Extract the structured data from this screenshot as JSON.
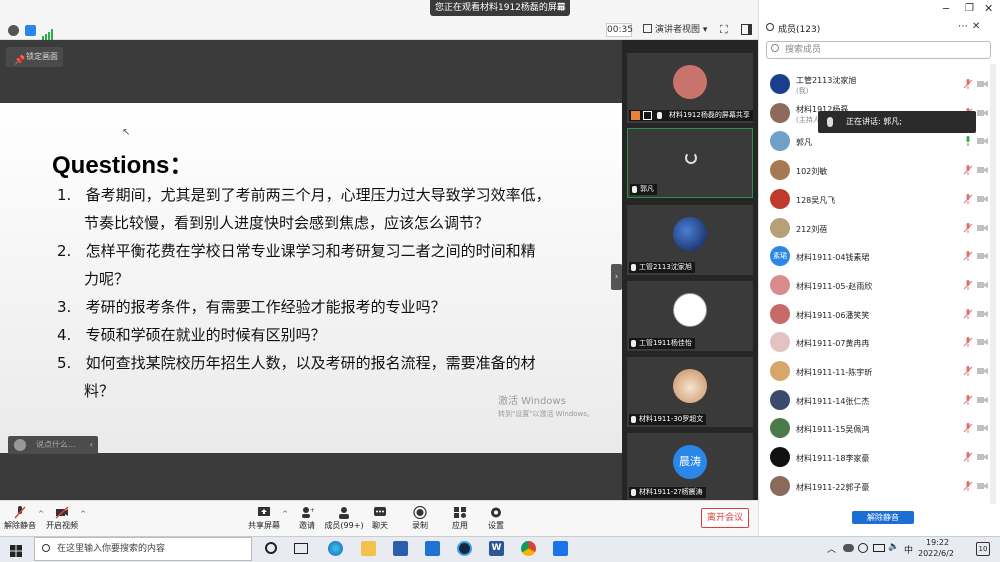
{
  "top": {
    "viewing_banner": "您正在观看材料1912杨磊的屏幕",
    "timer": "00:35",
    "view_mode": "演讲者视图"
  },
  "share": {
    "lock_label": "锁定画面",
    "chat_placeholder": "说点什么...",
    "slide": {
      "title": "Questions：",
      "questions": [
        {
          "num": "1.",
          "lines": [
            "备考期间，尤其是到了考前两三个月，心理压力过大导致学习效率低，",
            "节奏比较慢，看到别人进度快时会感到焦虑，应该怎么调节？"
          ]
        },
        {
          "num": "2.",
          "lines": [
            "怎样平衡花费在学校日常专业课学习和考研复习二者之间的时间和精",
            "力呢？"
          ]
        },
        {
          "num": "3.",
          "lines": [
            "考研的报考条件，有需要工作经验才能报考的专业吗？"
          ]
        },
        {
          "num": "4.",
          "lines": [
            "专硕和学硕在就业的时候有区别吗？"
          ]
        },
        {
          "num": "5.",
          "lines": [
            "如何查找某院校历年招生人数，以及考研的报名流程，需要准备的材",
            "料？"
          ]
        }
      ],
      "watermark_line1": "激活 Windows",
      "watermark_line2": "转到\"设置\"以激活 Windows。"
    }
  },
  "video_tiles": [
    {
      "label": "材料1912杨磊的屏幕共享",
      "avatar_color": "#c9736d"
    },
    {
      "label": "郭凡",
      "avatar_color": ""
    },
    {
      "label": "工管2113沈家旭",
      "avatar_color": "#1b3f8f"
    },
    {
      "label": "工管1911杨佳怡",
      "avatar_color": "#ffffff"
    },
    {
      "label": "材料1911-30罗超文",
      "avatar_color": "#e8c7a0"
    },
    {
      "label": "材料1911-2?杨晨涛",
      "avatar_color": "#2a86e8",
      "avatar_text": "晨涛"
    }
  ],
  "toolbar": {
    "unmute": "解除静音",
    "start_video": "开启视频",
    "share_screen": "共享屏幕",
    "invite": "邀请",
    "members": "成员(99+)",
    "chat": "聊天",
    "record": "录制",
    "apps": "应用",
    "settings": "设置",
    "leave": "离开会议"
  },
  "members_panel": {
    "title": "成员(123)",
    "search_placeholder": "搜索成员",
    "speaking_tip": "正在讲话: 郭凡;",
    "unmute_all": "解除静音",
    "members": [
      {
        "name": "工管2113沈家旭",
        "sub": "(我)",
        "avatar_color": "#1b3f8f",
        "mic_on": false
      },
      {
        "name": "材料1912杨磊",
        "sub": "(主持人)",
        "avatar_color": "#8c6b5c",
        "mic_on": false
      },
      {
        "name": "郭凡",
        "sub": "",
        "avatar_color": "#6fa0c8",
        "mic_on": true
      },
      {
        "name": "102刘敏",
        "sub": "",
        "avatar_color": "#a57a50",
        "mic_on": false
      },
      {
        "name": "128吴凡飞",
        "sub": "",
        "avatar_color": "#c03a2b",
        "mic_on": false
      },
      {
        "name": "212刘蓓",
        "sub": "",
        "avatar_color": "#b5a07a",
        "mic_on": false
      },
      {
        "name": "材料1911-04钱素珺",
        "sub": "",
        "avatar_color": "#2a86e8",
        "avatar_text": "素珺",
        "mic_on": false
      },
      {
        "name": "材料1911-05-赵雨欣",
        "sub": "",
        "avatar_color": "#d98c8c",
        "mic_on": false
      },
      {
        "name": "材料1911-06潘笑笑",
        "sub": "",
        "avatar_color": "#c76a6a",
        "mic_on": false
      },
      {
        "name": "材料1911-07黄冉冉",
        "sub": "",
        "avatar_color": "#e2c3c0",
        "mic_on": false
      },
      {
        "name": "材料1911-11-陈宇昕",
        "sub": "",
        "avatar_color": "#d8a66a",
        "mic_on": false
      },
      {
        "name": "材料1911-14张仁杰",
        "sub": "",
        "avatar_color": "#3a4a6a",
        "mic_on": false
      },
      {
        "name": "材料1911-15吴佩鸿",
        "sub": "",
        "avatar_color": "#4a7a4a",
        "mic_on": false
      },
      {
        "name": "材料1911-18李家豪",
        "sub": "",
        "avatar_color": "#111111",
        "mic_on": false
      },
      {
        "name": "材料1911-22郭子豪",
        "sub": "",
        "avatar_color": "#8a6a5a",
        "mic_on": false
      }
    ]
  },
  "taskbar": {
    "search_placeholder": "在这里输入你要搜索的内容",
    "time": "19:22",
    "date": "2022/6/2",
    "ime": "中",
    "notifications": "10"
  }
}
